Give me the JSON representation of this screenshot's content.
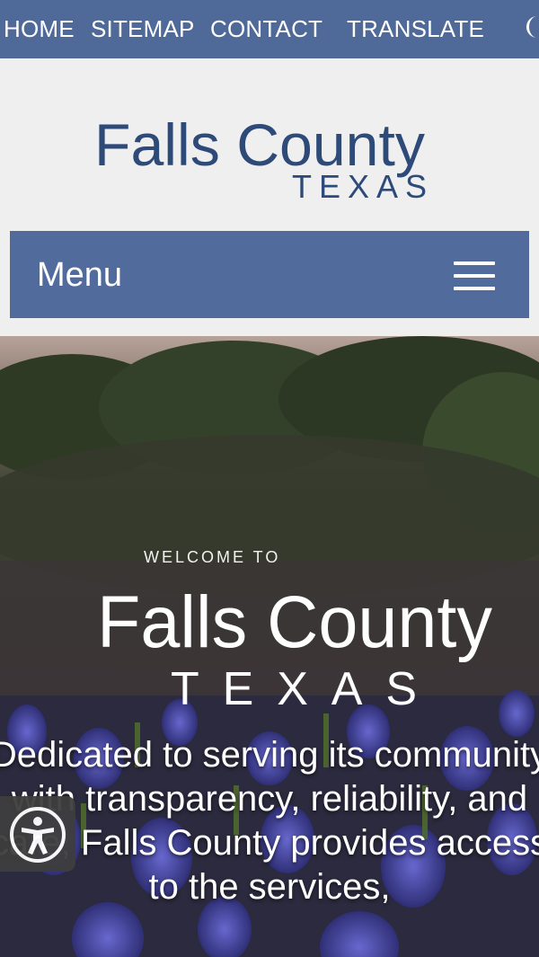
{
  "topnav": {
    "home": "HOME",
    "sitemap": "SITEMAP",
    "contact": "CONTACT",
    "translate": "TRANSLATE"
  },
  "logo": {
    "name": "Falls County",
    "state": "TEXAS"
  },
  "menu": {
    "label": "Menu"
  },
  "hero": {
    "welcome": "WELCOME TO",
    "title": "Falls County",
    "state": "TEXAS",
    "tagline": "Dedicated to serving its community with transparency, reliability, and care, Falls County provides access to the services,"
  },
  "colors": {
    "nav_blue": "#4f6a98",
    "logo_navy": "#2d4a78",
    "menu_blue": "#516c9c"
  },
  "icons": {
    "theme_toggle": "moon-icon",
    "menu": "hamburger-icon",
    "accessibility": "accessibility-icon"
  }
}
